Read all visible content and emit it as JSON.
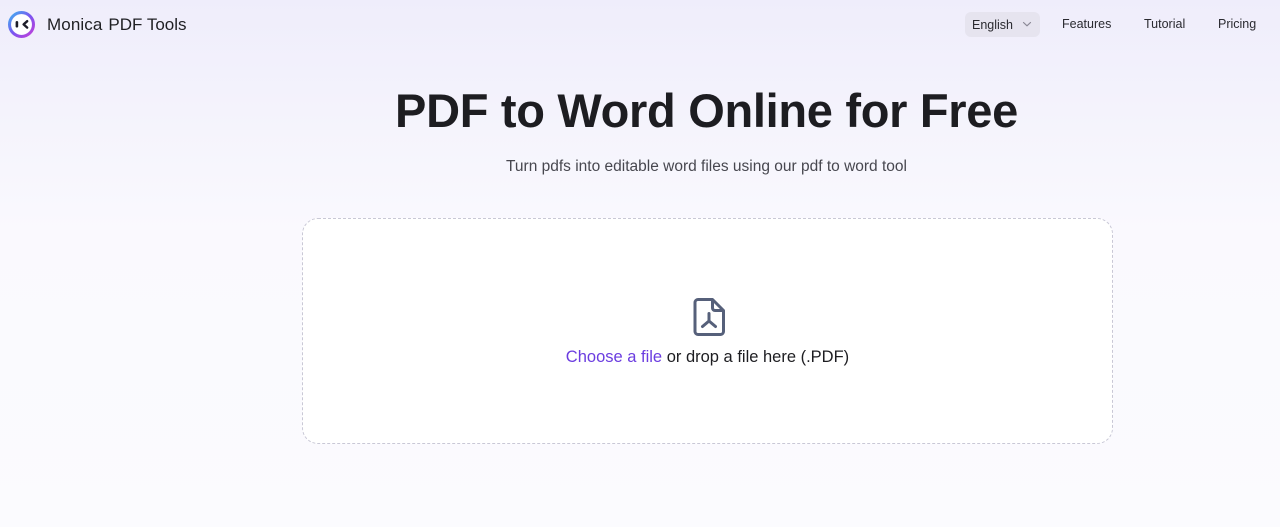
{
  "header": {
    "brand_name": "Monica",
    "brand_suffix": "PDF Tools",
    "language": "English",
    "nav": {
      "features": "Features",
      "tutorial": "Tutorial",
      "pricing": "Pricing"
    }
  },
  "hero": {
    "title": "PDF to Word Online for Free",
    "subtitle": "Turn pdfs into editable word files using our pdf to word tool"
  },
  "upload": {
    "choose_label": "Choose a file",
    "drop_label": " or drop a file here (.PDF)",
    "icon": "pdf-file-icon"
  },
  "colors": {
    "accent": "#6b3de0",
    "text": "#1d1d21",
    "icon": "#56607a"
  }
}
